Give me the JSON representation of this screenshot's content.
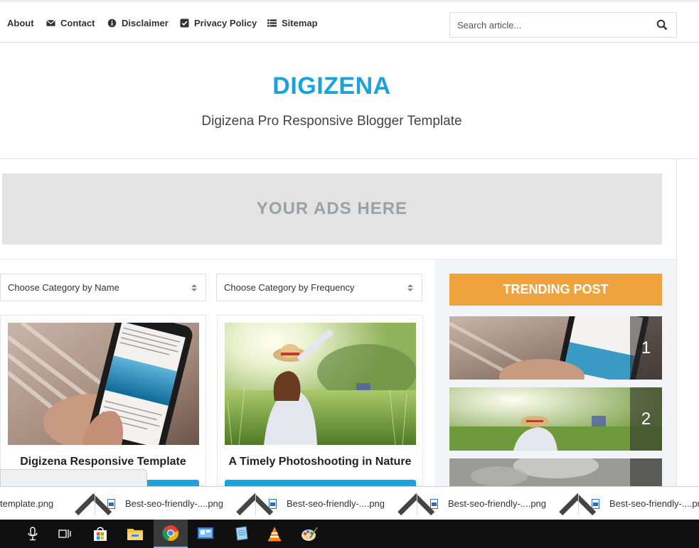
{
  "nav": {
    "items": [
      {
        "label": "About",
        "icon": "info-icon"
      },
      {
        "label": "Contact",
        "icon": "envelope-icon"
      },
      {
        "label": "Disclaimer",
        "icon": "info-circle-icon"
      },
      {
        "label": "Privacy Policy",
        "icon": "check-square-icon"
      },
      {
        "label": "Sitemap",
        "icon": "list-icon"
      }
    ],
    "search_placeholder": "Search article..."
  },
  "header": {
    "title": "DIGIZENA",
    "description": "Digizena Pro Responsive Blogger Template",
    "title_color": "#1aa2dc"
  },
  "ad": {
    "text": "YOUR ADS HERE"
  },
  "filters": {
    "by_name": "Choose Category by Name",
    "by_frequency": "Choose Category by Frequency"
  },
  "posts": [
    {
      "title": "Digizena Responsive Template"
    },
    {
      "title": "A Timely Photoshooting in Nature"
    }
  ],
  "sidebar": {
    "heading": "TRENDING POST",
    "heading_color": "#eea33f",
    "items": [
      {
        "rank": "1"
      },
      {
        "rank": "2"
      },
      {
        "rank": ""
      }
    ]
  },
  "downloads": [
    {
      "name": "template.png"
    },
    {
      "name": "Best-seo-friendly-....png"
    },
    {
      "name": "Best-seo-friendly-....png"
    },
    {
      "name": "Best-seo-friendly-....png"
    },
    {
      "name": "Best-seo-friendly-....png"
    }
  ],
  "taskbar": {
    "icons": [
      "microphone-icon",
      "task-view-icon",
      "store-icon",
      "file-explorer-icon",
      "chrome-icon",
      "control-panel-icon",
      "notepad-icon",
      "vlc-icon",
      "paint-icon"
    ]
  }
}
